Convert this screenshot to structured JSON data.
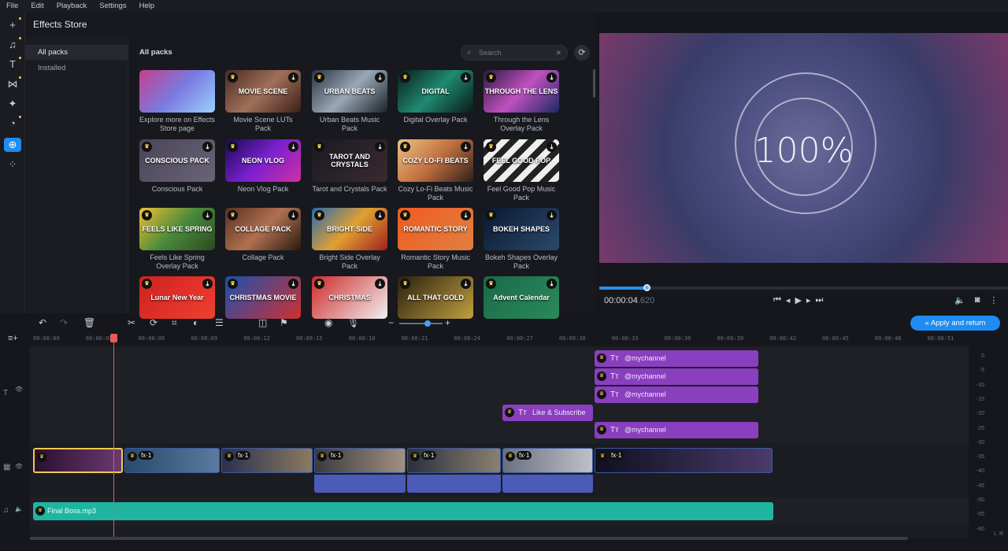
{
  "menu": [
    "File",
    "Edit",
    "Playback",
    "Settings",
    "Help"
  ],
  "rail": [
    {
      "icon": "plus-icon"
    },
    {
      "icon": "music-icon"
    },
    {
      "icon": "text-icon"
    },
    {
      "icon": "transitions-icon"
    },
    {
      "icon": "effects-icon"
    },
    {
      "icon": "stickers-icon"
    },
    {
      "icon": "effects-store-icon",
      "active": true
    },
    {
      "icon": "more-tools-icon"
    }
  ],
  "store": {
    "title": "Effects Store",
    "sidebar": [
      "All packs",
      "Installed"
    ],
    "grid_title": "All packs",
    "search_placeholder": "Search",
    "packs": [
      {
        "label": "Explore more on Effects Store page",
        "thumb": "",
        "bg": "linear-gradient(135deg,#c4408a,#7a7ae0,#9ad0ff)",
        "premium": false
      },
      {
        "label": "Movie Scene LUTs Pack",
        "thumb": "MOVIE SCENE",
        "bg": "linear-gradient(135deg,#4a2a22,#a0705a,#3a2018)",
        "premium": true
      },
      {
        "label": "Urban Beats Music Pack",
        "thumb": "URBAN BEATS",
        "bg": "linear-gradient(135deg,#2a3340,#9aa8b8,#1c2228)",
        "premium": true
      },
      {
        "label": "Digital Overlay Pack",
        "thumb": "DIGITAL",
        "bg": "linear-gradient(135deg,#0a1a18,#1f8a70,#0a1a18)",
        "premium": true
      },
      {
        "label": "Through the Lens Overlay Pack",
        "thumb": "THROUGH THE LENS",
        "bg": "linear-gradient(135deg,#2a1a40,#c050c0,#1a2a60)",
        "premium": true
      },
      {
        "label": "Conscious Pack",
        "thumb": "CONSCIOUS PACK",
        "bg": "linear-gradient(135deg,#4a4458,#6a6478)",
        "premium": true
      },
      {
        "label": "Neon Vlog Pack",
        "thumb": "NEON VLOG",
        "bg": "linear-gradient(135deg,#1a0a50,#7a20d0,#d030a0)",
        "premium": true
      },
      {
        "label": "Tarot and Crystals Pack",
        "thumb": "TAROT AND CRYSTALS",
        "bg": "linear-gradient(135deg,#1a1a22,#3a2a30)",
        "premium": true
      },
      {
        "label": "Cozy Lo-Fi Beats Music Pack",
        "thumb": "COZY LO-FI BEATS",
        "bg": "linear-gradient(135deg,#f0c080,#c07040,#302018)",
        "premium": true
      },
      {
        "label": "Feel Good Pop Music Pack",
        "thumb": "FEEL GOOD POP",
        "bg": "repeating-linear-gradient(135deg,#eee 0 8px,#222 8px 16px)",
        "premium": true
      },
      {
        "label": "Feels Like Spring Overlay Pack",
        "thumb": "FEELS LIKE SPRING",
        "bg": "linear-gradient(135deg,#f0c030,#4a8a3a,#2a4a20)",
        "premium": true
      },
      {
        "label": "Collage Pack",
        "thumb": "COLLAGE PACK",
        "bg": "linear-gradient(135deg,#5a3020,#b07050,#2a1a10)",
        "premium": true
      },
      {
        "label": "Bright Side Overlay Pack",
        "thumb": "BRIGHT SIDE",
        "bg": "linear-gradient(135deg,#2a6ab0,#e0a030,#a02020)",
        "premium": true
      },
      {
        "label": "Romantic Story Music Pack",
        "thumb": "ROMANTIC STORY",
        "bg": "linear-gradient(135deg,#f05a20,#e08040)",
        "premium": true
      },
      {
        "label": "Bokeh Shapes Overlay Pack",
        "thumb": "BOKEH SHAPES",
        "bg": "linear-gradient(135deg,#0a1830,#2a4a6a)",
        "premium": true
      },
      {
        "label": "",
        "thumb": "Lunar New Year",
        "bg": "linear-gradient(135deg,#d02020,#f04030)",
        "premium": true
      },
      {
        "label": "",
        "thumb": "CHRISTMAS MOVIE",
        "bg": "linear-gradient(135deg,#1a50b0,#d03030)",
        "premium": true
      },
      {
        "label": "",
        "thumb": "CHRISTMAS",
        "bg": "linear-gradient(135deg,#d02a2a,#f0f0f0)",
        "premium": true
      },
      {
        "label": "",
        "thumb": "ALL THAT GOLD",
        "bg": "linear-gradient(135deg,#2a2010,#c0a040)",
        "premium": true
      },
      {
        "label": "",
        "thumb": "Advent Calendar",
        "bg": "linear-gradient(135deg,#1a6a4a,#2a8a5a)",
        "premium": true
      }
    ]
  },
  "player": {
    "overlay_text": "100%",
    "time": "00:00:04",
    "time_ms": ".620",
    "progress_pct": 11.5
  },
  "apply_label": "Apply and return",
  "ruler": [
    "00:00:00",
    "00:00:03",
    "00:00:06",
    "00:00:09",
    "00:00:12",
    "00:00:15",
    "00:00:18",
    "00:00:21",
    "00:00:24",
    "00:00:27",
    "00:00:30",
    "00:00:33",
    "00:00:36",
    "00:00:39",
    "00:00:42",
    "00:00:45",
    "00:00:48",
    "00:00:51"
  ],
  "text_clips": [
    "@mychannel",
    "@mychannel",
    "@mychannel",
    "Like & Subscribe",
    "@mychannel"
  ],
  "fx_label": "fx·1",
  "music_clip": "Final Boss.mp3",
  "meter": [
    "0",
    "-5",
    "-10",
    "-15",
    "-20",
    "-25",
    "-30",
    "-35",
    "-40",
    "-45",
    "-50",
    "-55",
    "-60"
  ],
  "meter_lr": [
    "L",
    "R"
  ],
  "colors": {
    "accent": "#1e8cf0",
    "text_clip": "#8a3fbf",
    "audio_clip": "#1fb5a0",
    "playhead": "#e85a5a"
  }
}
